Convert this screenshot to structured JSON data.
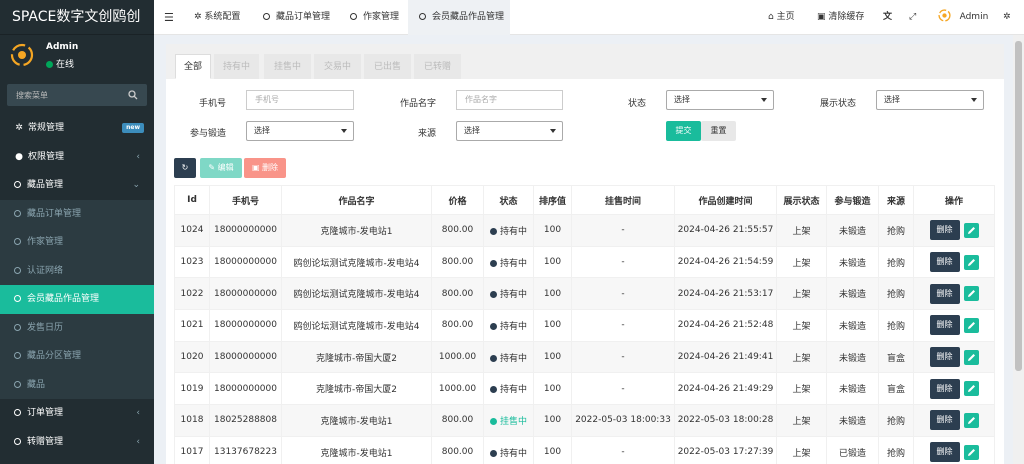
{
  "brand": {
    "title": "SPACE数字文创鸥创"
  },
  "user": {
    "name": "Admin",
    "status": "在线"
  },
  "sidebar": {
    "search_placeholder": "搜索菜单",
    "items": [
      {
        "label": "常规管理",
        "badge": "new"
      },
      {
        "label": "权限管理"
      },
      {
        "label": "藏品管理"
      }
    ],
    "sub": [
      {
        "label": "藏品订单管理"
      },
      {
        "label": "作家管理"
      },
      {
        "label": "认证网络"
      },
      {
        "label": "会员藏品作品管理"
      },
      {
        "label": "发售日历"
      },
      {
        "label": "藏品分区管理"
      },
      {
        "label": "藏品"
      }
    ],
    "items2": [
      {
        "label": "订单管理"
      },
      {
        "label": "转赠管理"
      }
    ]
  },
  "topbar": {
    "tabs": [
      {
        "label": "系统配置"
      },
      {
        "label": "藏品订单管理"
      },
      {
        "label": "作家管理"
      },
      {
        "label": "会员藏品作品管理"
      }
    ],
    "home": "主页",
    "clear_cache": "清除缓存",
    "admin": "Admin"
  },
  "tabs": [
    "全部",
    "持有中",
    "挂售中",
    "交易中",
    "已出售",
    "已转赠"
  ],
  "filters": {
    "phone_label": "手机号",
    "phone_placeholder": "手机号",
    "name_label": "作品名字",
    "name_placeholder": "作品名字",
    "status_label": "状态",
    "status_value": "选择",
    "display_label": "展示状态",
    "display_value": "选择",
    "forge_label": "参与锻造",
    "forge_value": "选择",
    "source_label": "来源",
    "source_value": "选择",
    "submit": "提交",
    "reset": "重置"
  },
  "toolbar": {
    "edit": "编辑",
    "delete": "删除"
  },
  "table": {
    "headers": [
      "Id",
      "手机号",
      "作品名字",
      "价格",
      "状态",
      "排序值",
      "挂售时间",
      "作品创建时间",
      "展示状态",
      "参与锻造",
      "来源",
      "操作"
    ],
    "rows": [
      {
        "id": "1024",
        "phone": "18000000000",
        "name": "克隆城市-发电站1",
        "price": "800.00",
        "status": "持有中",
        "sort": "100",
        "sale_time": "-",
        "created": "2024-04-26 21:55:57",
        "display": "上架",
        "forge": "未锻造",
        "source": "抢购"
      },
      {
        "id": "1023",
        "phone": "18000000000",
        "name": "鸥创论坛测试克隆城市-发电站4",
        "price": "800.00",
        "status": "持有中",
        "sort": "100",
        "sale_time": "-",
        "created": "2024-04-26 21:54:59",
        "display": "上架",
        "forge": "未锻造",
        "source": "抢购"
      },
      {
        "id": "1022",
        "phone": "18000000000",
        "name": "鸥创论坛测试克隆城市-发电站4",
        "price": "800.00",
        "status": "持有中",
        "sort": "100",
        "sale_time": "-",
        "created": "2024-04-26 21:53:17",
        "display": "上架",
        "forge": "未锻造",
        "source": "抢购"
      },
      {
        "id": "1021",
        "phone": "18000000000",
        "name": "鸥创论坛测试克隆城市-发电站4",
        "price": "800.00",
        "status": "持有中",
        "sort": "100",
        "sale_time": "-",
        "created": "2024-04-26 21:52:48",
        "display": "上架",
        "forge": "未锻造",
        "source": "抢购"
      },
      {
        "id": "1020",
        "phone": "18000000000",
        "name": "克隆城市-帝国大厦2",
        "price": "1000.00",
        "status": "持有中",
        "sort": "100",
        "sale_time": "-",
        "created": "2024-04-26 21:49:41",
        "display": "上架",
        "forge": "未锻造",
        "source": "盲盒"
      },
      {
        "id": "1019",
        "phone": "18000000000",
        "name": "克隆城市-帝国大厦2",
        "price": "1000.00",
        "status": "持有中",
        "sort": "100",
        "sale_time": "-",
        "created": "2024-04-26 21:49:29",
        "display": "上架",
        "forge": "未锻造",
        "source": "盲盒"
      },
      {
        "id": "1018",
        "phone": "18025288808",
        "name": "克隆城市-发电站1",
        "price": "800.00",
        "status": "挂售中",
        "sort": "100",
        "sale_time": "2022-05-03 18:00:33",
        "created": "2022-05-03 18:00:28",
        "display": "上架",
        "forge": "未锻造",
        "source": "抢购"
      },
      {
        "id": "1017",
        "phone": "13137678223",
        "name": "克隆城市-发电站1",
        "price": "800.00",
        "status": "持有中",
        "sort": "100",
        "sale_time": "-",
        "created": "2022-05-03 17:27:39",
        "display": "上架",
        "forge": "已锻造",
        "source": "抢购"
      }
    ],
    "delete_label": "删除"
  },
  "colors": {
    "accent": "#1abc9c",
    "sidebar": "#222d32",
    "dark_btn": "#2c3e50",
    "danger": "#f75444",
    "online": "#00a65a",
    "status_hold": "#2c3e50"
  }
}
